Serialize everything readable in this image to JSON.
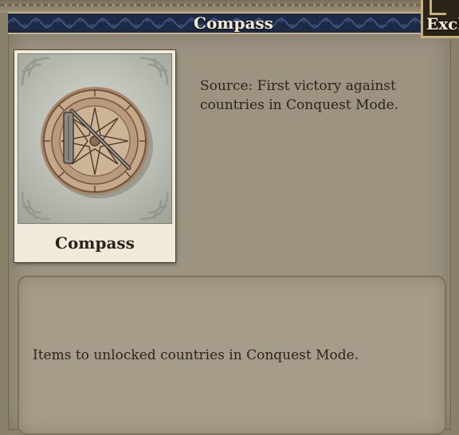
{
  "header": {
    "title": "Compass",
    "tab_label": "Excl"
  },
  "item": {
    "name": "Compass",
    "icon": "compass-icon",
    "source": "Source: First victory against countries in Conquest Mode."
  },
  "description": "Items to unlocked countries in Conquest Mode.",
  "colors": {
    "title_bar": "#1d2a45",
    "panel": "#9c9381",
    "text": "#2c2517",
    "gold_trim": "#c8b48a"
  }
}
